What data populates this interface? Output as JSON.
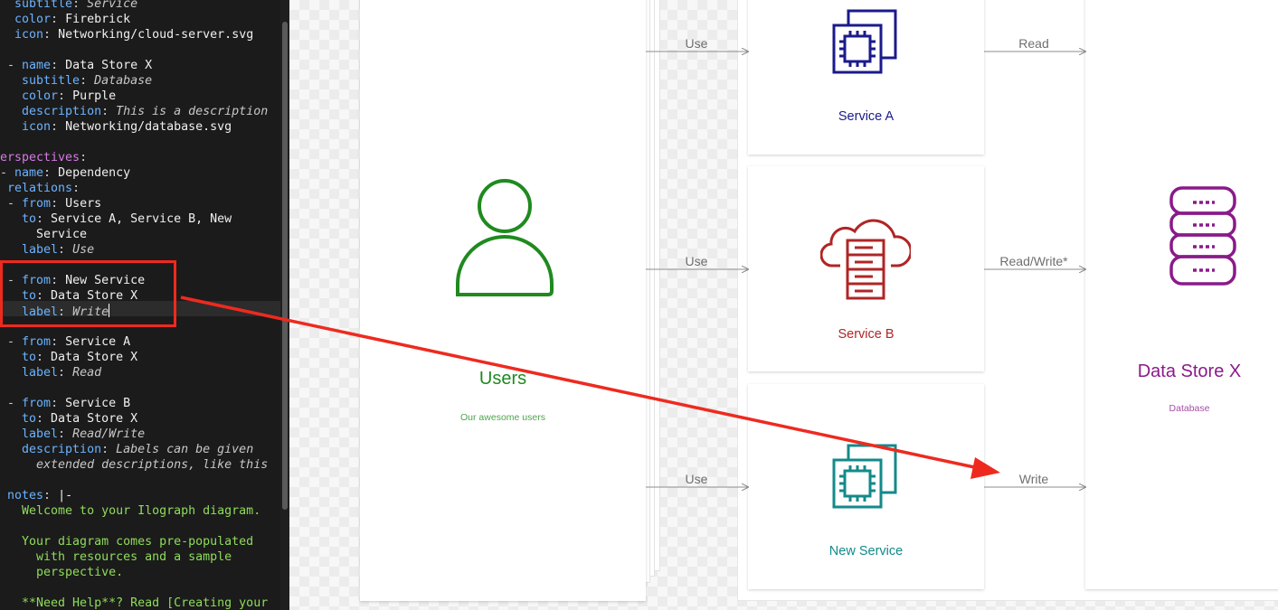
{
  "editor": {
    "lines": [
      {
        "parts": [
          [
            "k",
            "  subtitle"
          ],
          [
            "c",
            ": "
          ],
          [
            "vi",
            "Service"
          ]
        ]
      },
      {
        "parts": [
          [
            "k",
            "  color"
          ],
          [
            "c",
            ": "
          ],
          [
            "v",
            "Firebrick"
          ]
        ]
      },
      {
        "parts": [
          [
            "k",
            "  icon"
          ],
          [
            "c",
            ": "
          ],
          [
            "v",
            "Networking/cloud-server.svg"
          ]
        ]
      },
      {
        "parts": []
      },
      {
        "parts": [
          [
            "c",
            " - "
          ],
          [
            "k",
            "name"
          ],
          [
            "c",
            ": "
          ],
          [
            "v",
            "Data Store X"
          ]
        ]
      },
      {
        "parts": [
          [
            "k",
            "   subtitle"
          ],
          [
            "c",
            ": "
          ],
          [
            "vi",
            "Database"
          ]
        ]
      },
      {
        "parts": [
          [
            "k",
            "   color"
          ],
          [
            "c",
            ": "
          ],
          [
            "v",
            "Purple"
          ]
        ]
      },
      {
        "parts": [
          [
            "k",
            "   description"
          ],
          [
            "c",
            ": "
          ],
          [
            "vi",
            "This is a description"
          ]
        ]
      },
      {
        "parts": [
          [
            "k",
            "   icon"
          ],
          [
            "c",
            ": "
          ],
          [
            "v",
            "Networking/database.svg"
          ]
        ]
      },
      {
        "parts": []
      },
      {
        "parts": [
          [
            "kp",
            "erspectives"
          ],
          [
            "c",
            ":"
          ]
        ]
      },
      {
        "parts": [
          [
            "c",
            "- "
          ],
          [
            "k",
            "name"
          ],
          [
            "c",
            ": "
          ],
          [
            "v",
            "Dependency"
          ]
        ]
      },
      {
        "parts": [
          [
            "k",
            " relations"
          ],
          [
            "c",
            ":"
          ]
        ]
      },
      {
        "parts": [
          [
            "c",
            " - "
          ],
          [
            "k",
            "from"
          ],
          [
            "c",
            ": "
          ],
          [
            "v",
            "Users"
          ]
        ]
      },
      {
        "parts": [
          [
            "k",
            "   to"
          ],
          [
            "c",
            ": "
          ],
          [
            "v",
            "Service A, Service B, New"
          ]
        ]
      },
      {
        "parts": [
          [
            "v",
            "     Service"
          ]
        ]
      },
      {
        "parts": [
          [
            "k",
            "   label"
          ],
          [
            "c",
            ": "
          ],
          [
            "vi",
            "Use"
          ]
        ]
      },
      {
        "parts": []
      },
      {
        "parts": [
          [
            "c",
            " - "
          ],
          [
            "k",
            "from"
          ],
          [
            "c",
            ": "
          ],
          [
            "v",
            "New Service"
          ]
        ]
      },
      {
        "parts": [
          [
            "k",
            "   to"
          ],
          [
            "c",
            ": "
          ],
          [
            "v",
            "Data Store X"
          ]
        ]
      },
      {
        "parts": [
          [
            "k",
            "   label"
          ],
          [
            "c",
            ": "
          ],
          [
            "vi",
            "Write"
          ]
        ],
        "cursor": true
      },
      {
        "parts": []
      },
      {
        "parts": [
          [
            "c",
            " - "
          ],
          [
            "k",
            "from"
          ],
          [
            "c",
            ": "
          ],
          [
            "v",
            "Service A"
          ]
        ]
      },
      {
        "parts": [
          [
            "k",
            "   to"
          ],
          [
            "c",
            ": "
          ],
          [
            "v",
            "Data Store X"
          ]
        ]
      },
      {
        "parts": [
          [
            "k",
            "   label"
          ],
          [
            "c",
            ": "
          ],
          [
            "vi",
            "Read"
          ]
        ]
      },
      {
        "parts": []
      },
      {
        "parts": [
          [
            "c",
            " - "
          ],
          [
            "k",
            "from"
          ],
          [
            "c",
            ": "
          ],
          [
            "v",
            "Service B"
          ]
        ]
      },
      {
        "parts": [
          [
            "k",
            "   to"
          ],
          [
            "c",
            ": "
          ],
          [
            "v",
            "Data Store X"
          ]
        ]
      },
      {
        "parts": [
          [
            "k",
            "   label"
          ],
          [
            "c",
            ": "
          ],
          [
            "vi",
            "Read/Write"
          ]
        ]
      },
      {
        "parts": [
          [
            "k",
            "   description"
          ],
          [
            "c",
            ": "
          ],
          [
            "vi",
            "Labels can be given"
          ]
        ]
      },
      {
        "parts": [
          [
            "vi",
            "     extended descriptions, like this"
          ]
        ]
      },
      {
        "parts": []
      },
      {
        "parts": [
          [
            "k",
            " notes"
          ],
          [
            "c",
            ": "
          ],
          [
            "v",
            "|-"
          ]
        ]
      },
      {
        "parts": [
          [
            "g",
            "   Welcome to your Ilograph diagram."
          ]
        ]
      },
      {
        "parts": []
      },
      {
        "parts": [
          [
            "g",
            "   Your diagram comes pre-populated"
          ]
        ]
      },
      {
        "parts": [
          [
            "g",
            "     with resources and a sample"
          ]
        ]
      },
      {
        "parts": [
          [
            "g",
            "     perspective."
          ]
        ]
      },
      {
        "parts": []
      },
      {
        "parts": [
          [
            "g",
            "   **Need Help**? Read [Creating your"
          ]
        ]
      }
    ]
  },
  "diagram": {
    "users": {
      "label": "Users",
      "subtitle": "Our awesome users",
      "color": "#1f8a1f",
      "icon": "user-icon"
    },
    "service_a": {
      "label": "Service A",
      "color": "#1a1a8c",
      "icon": "chip-icon"
    },
    "service_b": {
      "label": "Service B",
      "color": "#b02525",
      "icon": "cloud-server-icon"
    },
    "new_service": {
      "label": "New Service",
      "color": "#138a8a",
      "icon": "chip-icon"
    },
    "data_store": {
      "label": "Data Store X",
      "subtitle": "Database",
      "color": "#8a1a8a",
      "icon": "database-icon"
    },
    "connections": {
      "use_a": "Use",
      "use_b": "Use",
      "use_new": "Use",
      "read": "Read",
      "read_write": "Read/Write*",
      "write": "Write"
    },
    "annotation_color": "#ee2a1f"
  }
}
